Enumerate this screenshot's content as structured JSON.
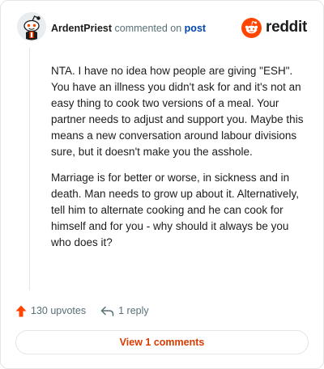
{
  "comment": {
    "author": "ArdentPriest",
    "action_text": " commented on ",
    "post_link": "post",
    "paragraphs": [
      "NTA. I have no idea how people are giving \"ESH\". You have an illness you didn't ask for and it's not an easy thing to cook two versions of a meal. Your partner needs to adjust and support you. Maybe this means a new conversation around labour divisions sure, but it doesn't make you the asshole.",
      "Marriage is for better or worse, in sickness and in death. Man needs to grow up about it. Alternatively, tell him to alternate cooking and he can cook for himself and for you - why should it always be you who does it?"
    ]
  },
  "brand": {
    "wordmark": "reddit",
    "icon": "reddit-snoo-icon",
    "color": "#ff4500"
  },
  "avatar": {
    "icon": "snoo-avatar-icon"
  },
  "actions": {
    "upvotes": "130 upvotes",
    "upvote_icon": "upvote-arrow-icon",
    "upvote_color": "#ff4500",
    "replies": "1 reply",
    "reply_icon": "reply-arrow-icon"
  },
  "view_button": {
    "label": "View 1 comments",
    "color": "#d93a00"
  }
}
